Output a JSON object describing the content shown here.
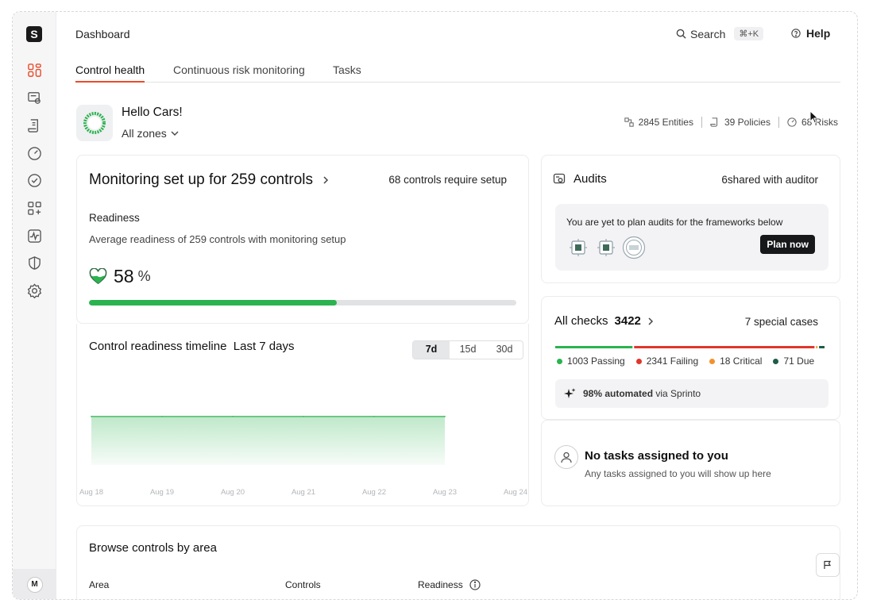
{
  "app": {
    "logo_letter": "S",
    "page_title": "Dashboard"
  },
  "header": {
    "search_label": "Search",
    "search_shortcut": "⌘+K",
    "help_label": "Help"
  },
  "tabs": [
    {
      "label": "Control health",
      "active": true
    },
    {
      "label": "Continuous risk monitoring",
      "active": false
    },
    {
      "label": "Tasks",
      "active": false
    }
  ],
  "greeting": {
    "hello": "Hello Cars!",
    "zones": "All zones"
  },
  "stats": {
    "entities": "2845 Entities",
    "policies": "39 Policies",
    "risks": "68 Risks"
  },
  "monitoring": {
    "title": "Monitoring set up for 259 controls",
    "setup": "68 controls require setup",
    "readiness_label": "Readiness",
    "readiness_sub": "Average readiness of 259 controls with monitoring setup",
    "percent": "58",
    "percent_unit": "%",
    "progress": 0.58
  },
  "timeline": {
    "title": "Control readiness timeline",
    "period": "Last 7 days",
    "ranges": [
      "7d",
      "15d",
      "30d"
    ],
    "active_range": "7d"
  },
  "chart_data": {
    "type": "area",
    "title": "Control readiness timeline",
    "x": [
      "Aug 18",
      "Aug 19",
      "Aug 20",
      "Aug 21",
      "Aug 22",
      "Aug 23",
      "Aug 24"
    ],
    "series": [
      {
        "values": [
          58,
          58,
          58,
          58,
          58,
          58,
          null
        ]
      }
    ],
    "ylim": [
      0,
      100
    ],
    "grid": false,
    "color": "#2bb34f"
  },
  "audits": {
    "title": "Audits",
    "shared": "6shared with auditor",
    "message": "You are yet to plan audits for the frameworks below",
    "plan_button": "Plan now"
  },
  "checks": {
    "title": "All checks",
    "count": "3422",
    "special": "7 special cases",
    "passing": "1003 Passing",
    "failing": "2341 Failing",
    "critical": "18 Critical",
    "due": "71 Due",
    "passing_n": 1003,
    "failing_n": 2341,
    "critical_n": 18,
    "due_n": 71,
    "automated": "98% automated",
    "automated_via": "via Sprinto",
    "colors": {
      "passing": "#2bb34f",
      "failing": "#e0362b",
      "critical": "#f2912c",
      "due": "#1f5c47"
    }
  },
  "tasks": {
    "title": "No tasks assigned to you",
    "sub": "Any tasks assigned to you will show up here"
  },
  "browse": {
    "title": "Browse controls by area",
    "columns": [
      "Area",
      "Controls",
      "Readiness"
    ]
  },
  "user": {
    "initial": "M"
  }
}
